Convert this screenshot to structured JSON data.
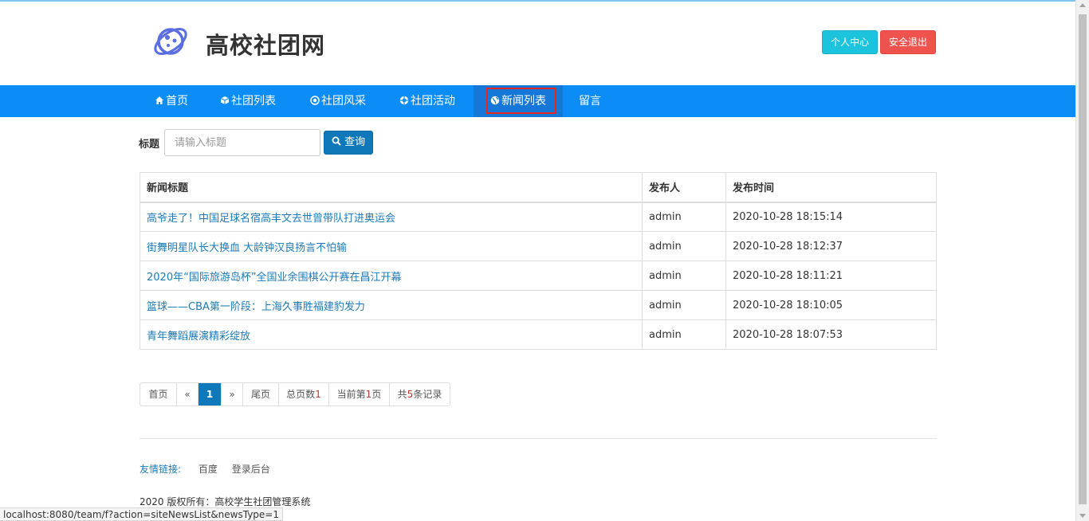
{
  "header": {
    "site_title": "高校社团网",
    "user_center": "个人中心",
    "logout": "安全退出"
  },
  "nav": {
    "items": [
      {
        "label": "首页",
        "icon": "home-icon"
      },
      {
        "label": "社团列表",
        "icon": "cube-icon"
      },
      {
        "label": "社团风采",
        "icon": "target-icon"
      },
      {
        "label": "社团活动",
        "icon": "lifebuoy-icon"
      },
      {
        "label": "新闻列表",
        "icon": "globe-icon"
      },
      {
        "label": "留言",
        "icon": ""
      }
    ],
    "active_index": 4
  },
  "search": {
    "label": "标题",
    "placeholder": "请输入标题",
    "button": "查询"
  },
  "table": {
    "headers": [
      "新闻标题",
      "发布人",
      "发布时间"
    ],
    "rows": [
      {
        "title": "高爷走了！中国足球名宿高丰文去世曾带队打进奥运会",
        "publisher": "admin",
        "time": "2020-10-28 18:15:14"
      },
      {
        "title": "街舞明星队长大换血 大龄钟汉良扬言不怕输",
        "publisher": "admin",
        "time": "2020-10-28 18:12:37"
      },
      {
        "title": "2020年“国际旅游岛杯”全国业余围棋公开赛在昌江开幕",
        "publisher": "admin",
        "time": "2020-10-28 18:11:21"
      },
      {
        "title": "篮球——CBA第一阶段：上海久事胜福建豹发力",
        "publisher": "admin",
        "time": "2020-10-28 18:10:05"
      },
      {
        "title": "青年舞蹈展演精彩绽放",
        "publisher": "admin",
        "time": "2020-10-28 18:07:53"
      }
    ]
  },
  "pager": {
    "first": "首页",
    "prev": "«",
    "current": "1",
    "next": "»",
    "last": "尾页",
    "total_pages_prefix": "总页数",
    "total_pages": "1",
    "current_page_prefix": "当前第",
    "current_page": "1",
    "current_page_suffix": "页",
    "records_prefix": "共",
    "records": "5",
    "records_suffix": "条记录"
  },
  "footer": {
    "links_label": "友情链接:",
    "links": [
      "百度",
      "登录后台"
    ],
    "copyright": "2020 版权所有：高校学生社团管理系统"
  },
  "status_bar": "localhost:8080/team/f?action=siteNewsList&newsType=1",
  "colors": {
    "nav_bg": "#0b8cf6",
    "accent": "#0f78b8",
    "link": "#1c7bb8",
    "user_btn": "#1cc3dc",
    "logout_btn": "#f0524e",
    "highlight_box": "#e8261e"
  }
}
